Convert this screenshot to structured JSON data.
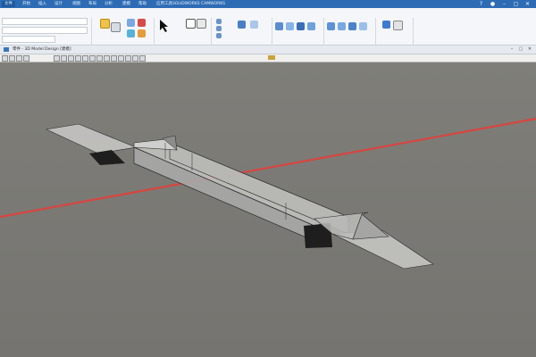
{
  "ribbon": {
    "tabs": [
      "文件",
      "开始",
      "插入",
      "设计",
      "视图",
      "布局",
      "分析",
      "建模",
      "帮助",
      "应用工具",
      "SOLIDWORKS",
      "CAMWORKS"
    ],
    "file_tab": "文件"
  },
  "document": {
    "title": "零件 - 3D Model Design [建模]"
  },
  "colors": {
    "title_bar": "#2d6cb5",
    "viewport_bg": "#7b7a75",
    "axis_line": "#d9453f",
    "part_fill": "#bfbfbd",
    "part_edge": "#2a2a2a"
  },
  "icons": [
    "user-icon",
    "help-icon",
    "minimize-icon",
    "maximize-icon",
    "close-icon",
    "cursor-icon",
    "gear-icon"
  ]
}
